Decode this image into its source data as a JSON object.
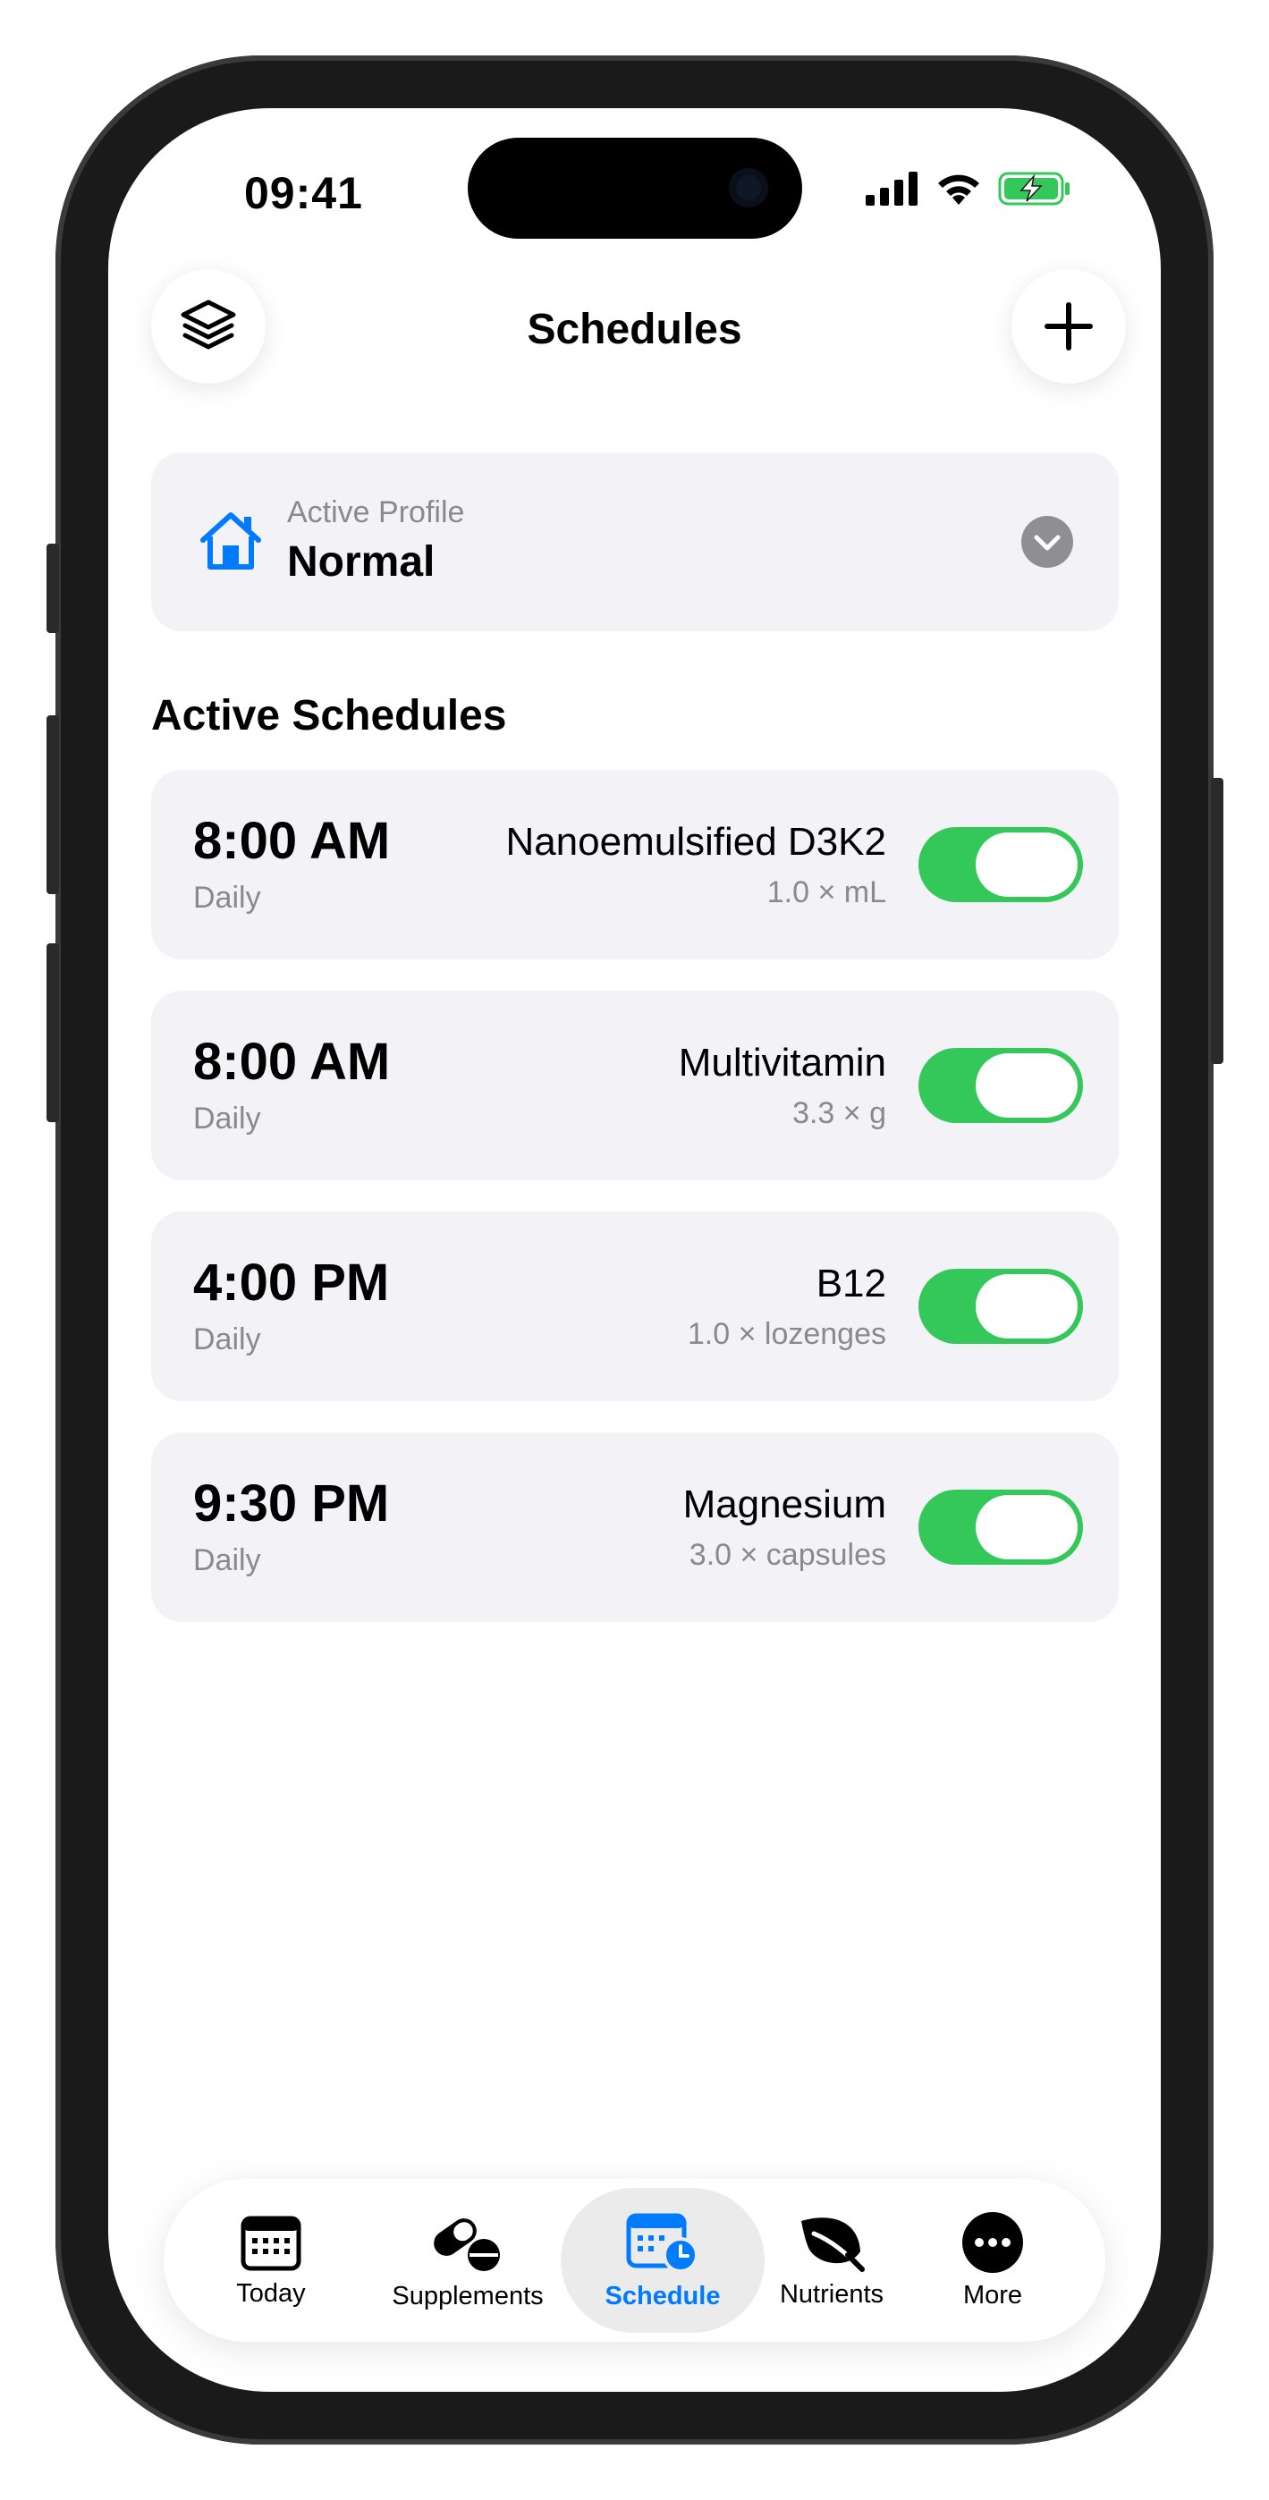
{
  "status_bar": {
    "time": "09:41"
  },
  "header": {
    "title": "Schedules"
  },
  "profile": {
    "label": "Active Profile",
    "value": "Normal"
  },
  "section": {
    "title": "Active Schedules"
  },
  "schedules": [
    {
      "time": "8:00 AM",
      "frequency": "Daily",
      "name": "Nanoemulsified D3K2",
      "dose": "1.0 × mL",
      "enabled": true
    },
    {
      "time": "8:00 AM",
      "frequency": "Daily",
      "name": "Multivitamin",
      "dose": "3.3 × g",
      "enabled": true
    },
    {
      "time": "4:00 PM",
      "frequency": "Daily",
      "name": "B12",
      "dose": "1.0 × lozenges",
      "enabled": true
    },
    {
      "time": "9:30 PM",
      "frequency": "Daily",
      "name": "Magnesium",
      "dose": "3.0 × capsules",
      "enabled": true
    }
  ],
  "tabbar": {
    "items": [
      {
        "label": "Today",
        "icon": "calendar-icon"
      },
      {
        "label": "Supplements",
        "icon": "pills-icon"
      },
      {
        "label": "Schedule",
        "icon": "calendar-clock-icon",
        "active": true
      },
      {
        "label": "Nutrients",
        "icon": "leaf-icon"
      },
      {
        "label": "More",
        "icon": "ellipsis-icon"
      }
    ]
  },
  "colors": {
    "accent": "#007aff",
    "toggle_on": "#34c759",
    "card_bg": "#f2f2f7",
    "secondary_text": "#8a8a8e",
    "battery": "#34c759"
  }
}
